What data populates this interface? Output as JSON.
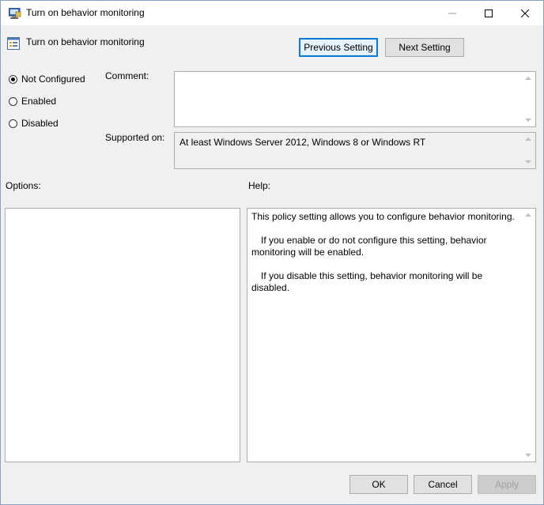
{
  "window": {
    "title": "Turn on behavior monitoring",
    "controls": [
      "minimize-icon",
      "maximize-icon",
      "close-icon"
    ]
  },
  "header": {
    "policy_title": "Turn on behavior monitoring",
    "previous_label": "Previous Setting",
    "next_label": "Next Setting"
  },
  "state": {
    "options": [
      "Not Configured",
      "Enabled",
      "Disabled"
    ],
    "selected": "Not Configured"
  },
  "comment": {
    "label": "Comment:",
    "value": ""
  },
  "supported": {
    "label": "Supported on:",
    "value": "At least Windows Server 2012, Windows 8 or Windows RT"
  },
  "options_panel": {
    "label": "Options:"
  },
  "help_panel": {
    "label": "Help:",
    "paragraphs": [
      "This policy setting allows you to configure behavior monitoring.",
      "If you enable or do not configure this setting, behavior monitoring will be enabled.",
      "If you disable this setting, behavior monitoring will be disabled."
    ]
  },
  "footer": {
    "ok_label": "OK",
    "cancel_label": "Cancel",
    "apply_label": "Apply"
  },
  "colors": {
    "focus_border": "#0078d7",
    "dialog_bg": "#f0f0f0"
  }
}
